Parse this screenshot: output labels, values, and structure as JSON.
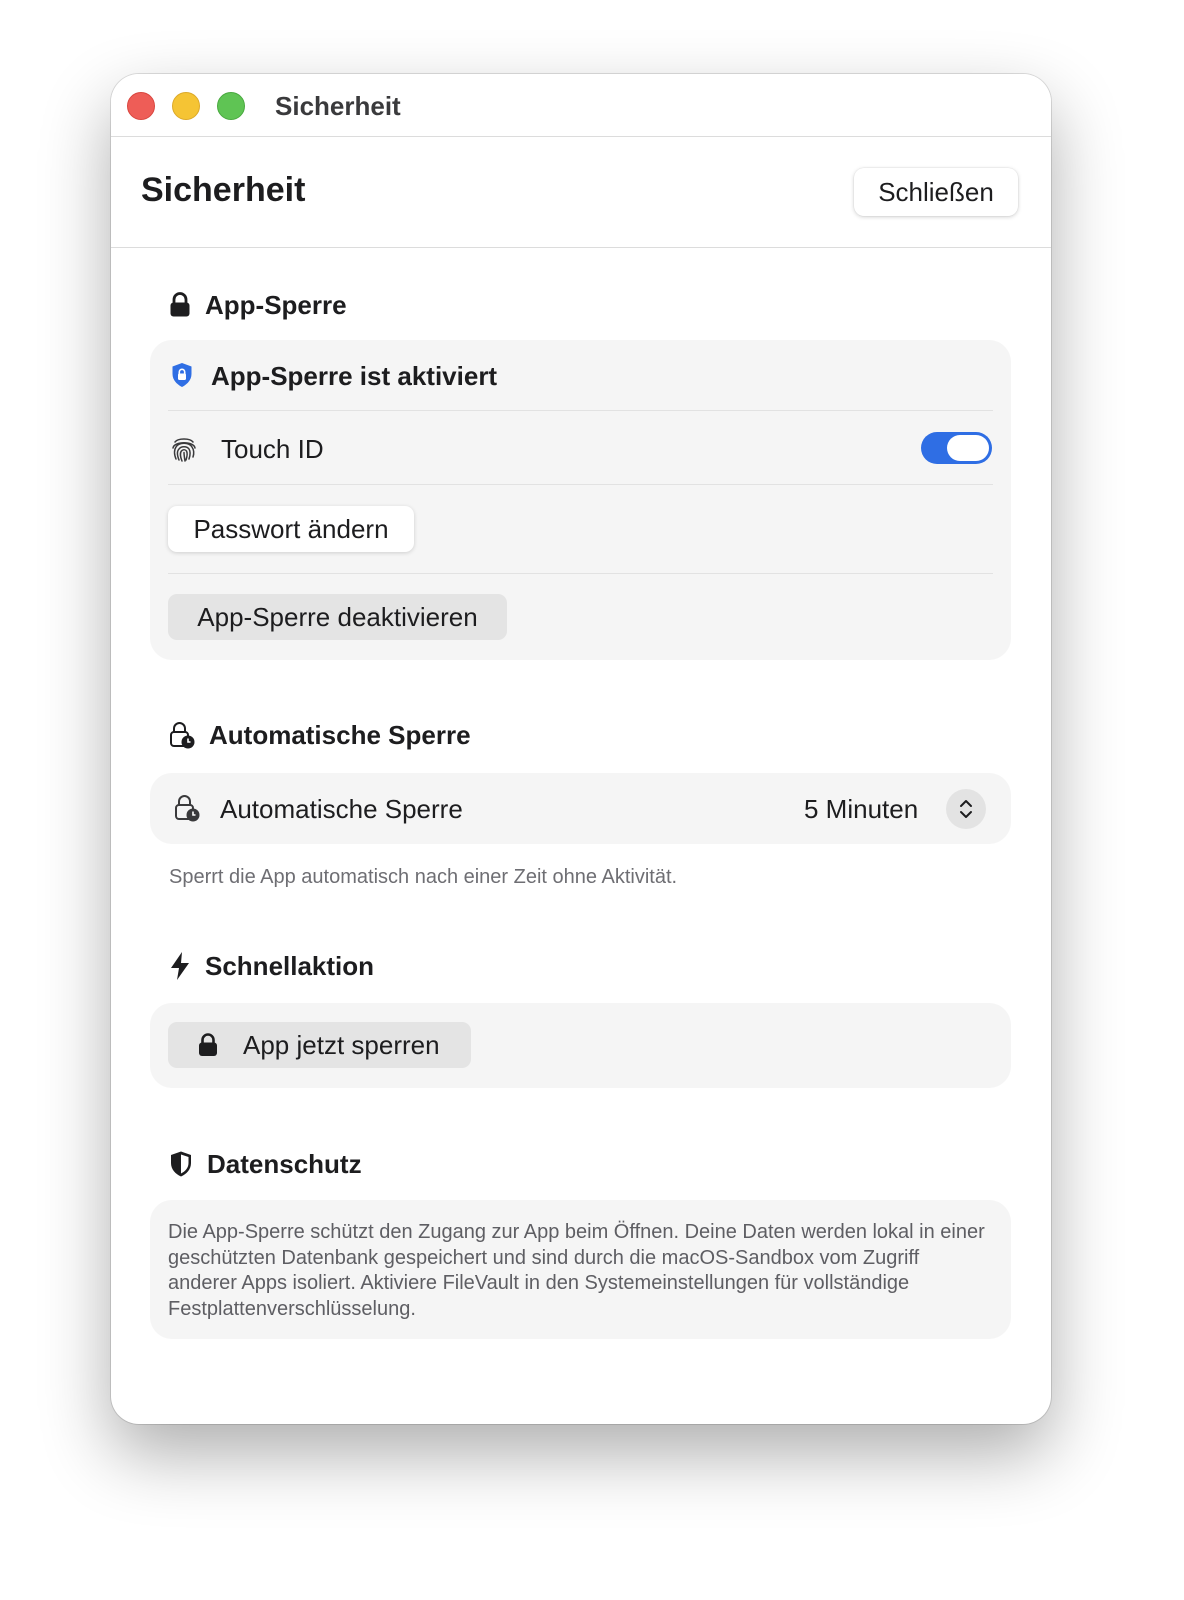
{
  "window": {
    "title": "Sicherheit"
  },
  "header": {
    "title": "Sicherheit",
    "close_label": "Schließen"
  },
  "app_lock": {
    "section_title": "App-Sperre",
    "status_text": "App-Sperre ist aktiviert",
    "touch_id_label": "Touch ID",
    "touch_id_enabled": true,
    "change_password_label": "Passwort ändern",
    "disable_label": "App-Sperre deaktivieren"
  },
  "auto_lock": {
    "section_title": "Automatische Sperre",
    "row_label": "Automatische Sperre",
    "selected_value": "5 Minuten",
    "hint": "Sperrt die App automatisch nach einer Zeit ohne Aktivität."
  },
  "quick_action": {
    "section_title": "Schnellaktion",
    "lock_now_label": "App jetzt sperren"
  },
  "privacy": {
    "section_title": "Datenschutz",
    "text": "Die App-Sperre schützt den Zugang zur App beim Öffnen. Deine Daten werden lokal in einer geschützten Datenbank gespeichert und sind durch die macOS-Sandbox vom Zugriff anderer Apps isoliert. Aktiviere FileVault in den Systemeinstellungen für vollständige Festplattenverschlüsselung."
  },
  "colors": {
    "accent": "#2f6ee4",
    "card_background": "#f5f5f5",
    "traffic_red": "#ee5d57",
    "traffic_yellow": "#f5c434",
    "traffic_green": "#5fc454"
  },
  "icons": {
    "app_lock": "lock-icon",
    "status": "shield-lock-icon",
    "touch_id": "fingerprint-icon",
    "auto_lock": "lock-clock-icon",
    "quick_action": "bolt-icon",
    "lock_now": "lock-icon",
    "privacy": "shield-icon",
    "stepper": "chevron-up-down-icon"
  }
}
